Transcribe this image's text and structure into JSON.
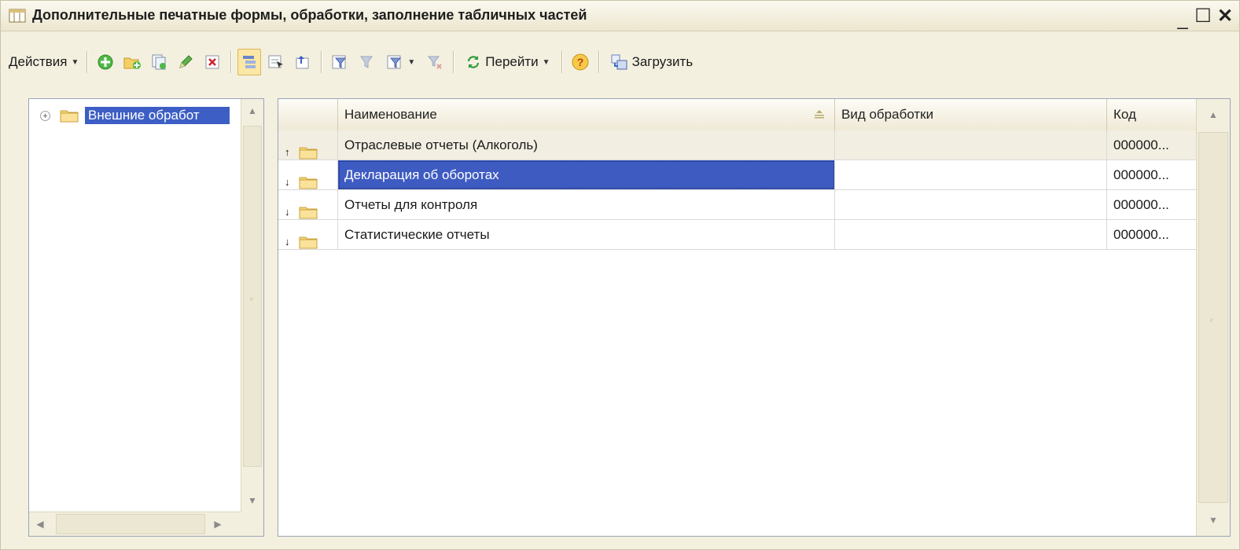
{
  "window": {
    "title": "Дополнительные печатные формы, обработки, заполнение табличных частей"
  },
  "toolbar": {
    "actions_label": "Действия",
    "goto_label": "Перейти",
    "load_label": "Загрузить"
  },
  "tree": {
    "items": [
      {
        "label": "Внешние обработ",
        "selected": true
      }
    ]
  },
  "grid": {
    "columns": [
      "Наименование",
      "Вид обработки",
      "Код"
    ],
    "rows": [
      {
        "name": "Отраслевые отчеты (Алкоголь)",
        "kind": "",
        "code": "000000...",
        "direction": "up"
      },
      {
        "name": "Декларация об оборотах",
        "kind": "",
        "code": "000000...",
        "direction": "down",
        "selected": true
      },
      {
        "name": "Отчеты для контроля",
        "kind": "",
        "code": "000000...",
        "direction": "down"
      },
      {
        "name": "Статистические отчеты",
        "kind": "",
        "code": "000000...",
        "direction": "down"
      }
    ]
  },
  "icons": {
    "toolbar": [
      "add-icon",
      "add-folder-icon",
      "copy-icon",
      "edit-icon",
      "delete-icon",
      "hierarchy-icon",
      "select-icon",
      "level-up-icon",
      "filter-icon",
      "filter-off-icon",
      "filter-dropdown-icon",
      "clear-filter-icon",
      "refresh-icon",
      "help-icon",
      "load-icon"
    ]
  },
  "colors": {
    "selection": "#3e5bc2",
    "window_bg": "#f4f0e0"
  }
}
